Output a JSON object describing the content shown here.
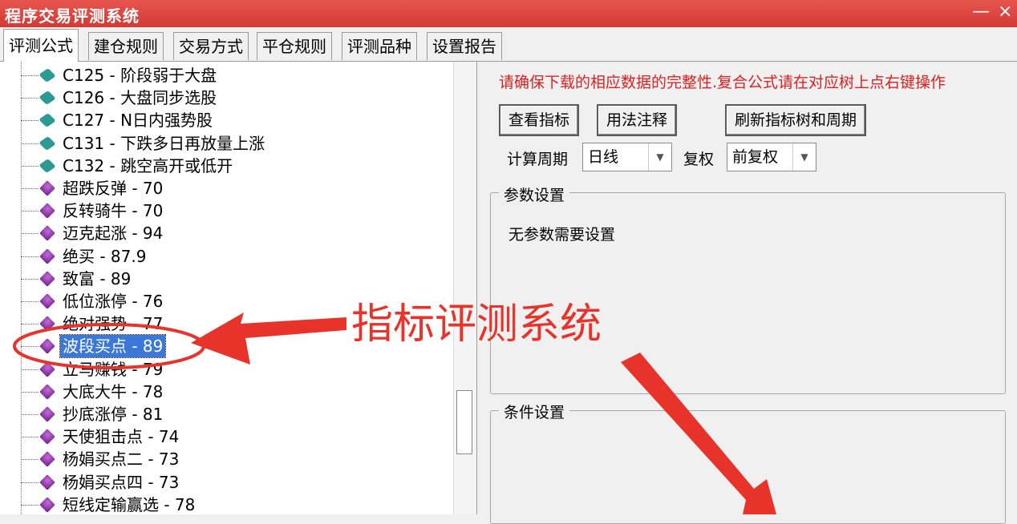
{
  "window": {
    "title": "程序交易评测系统",
    "close_glyph": "×",
    "minimize_glyph": "—"
  },
  "tabs": [
    {
      "label": "评测公式",
      "active": true
    },
    {
      "label": "建仓规则"
    },
    {
      "label": "交易方式"
    },
    {
      "label": "平仓规则"
    },
    {
      "label": "评测品种"
    },
    {
      "label": "设置报告"
    }
  ],
  "tree": {
    "items": [
      {
        "label": "C125 - 阶段弱于大盘",
        "icon": "teal-diamond-icon"
      },
      {
        "label": "C126 - 大盘同步选股",
        "icon": "teal-diamond-icon"
      },
      {
        "label": "C127 - N日内强势股",
        "icon": "teal-diamond-icon"
      },
      {
        "label": "C131 - 下跌多日再放量上涨",
        "icon": "teal-diamond-icon"
      },
      {
        "label": "C132 - 跳空高开或低开",
        "icon": "teal-diamond-icon"
      },
      {
        "label": "超跌反弹 - 70",
        "icon": "purple-gem-icon"
      },
      {
        "label": "反转骑牛 - 70",
        "icon": "purple-gem-icon"
      },
      {
        "label": "迈克起涨 - 94",
        "icon": "purple-gem-icon"
      },
      {
        "label": "绝买 - 87.9",
        "icon": "purple-gem-icon"
      },
      {
        "label": "致富 - 89",
        "icon": "purple-gem-icon"
      },
      {
        "label": "低位涨停 - 76",
        "icon": "purple-gem-icon"
      },
      {
        "label": "绝对强势 - 77",
        "icon": "purple-gem-icon"
      },
      {
        "label": "波段买点 - 89",
        "icon": "purple-gem-icon",
        "selected": true
      },
      {
        "label": "立马赚钱 - 79",
        "icon": "purple-gem-icon"
      },
      {
        "label": "大底大牛 - 78",
        "icon": "purple-gem-icon"
      },
      {
        "label": "抄底涨停 - 81",
        "icon": "purple-gem-icon"
      },
      {
        "label": "天使狙击点 - 74",
        "icon": "purple-gem-icon"
      },
      {
        "label": "杨娟买点二 - 73",
        "icon": "purple-gem-icon"
      },
      {
        "label": "杨娟买点四 - 73",
        "icon": "purple-gem-icon"
      },
      {
        "label": "短线定输赢选 - 78",
        "icon": "purple-gem-icon"
      }
    ]
  },
  "right": {
    "notice": "请确保下载的相应数据的完整性.复合公式请在对应树上点右键操作",
    "buttons": {
      "view_indicator": "查看指标",
      "usage_notes": "用法注释",
      "refresh_tree": "刷新指标树和周期"
    },
    "period_label": "计算周期",
    "period_value": "日线",
    "adjust_label": "复权",
    "adjust_value": "前复权",
    "params_group_title": "参数设置",
    "params_body": "无参数需要设置",
    "conditions_group_title": "条件设置"
  },
  "annotation": {
    "text": "指标评测系统",
    "color": "#e8332a"
  },
  "colors": {
    "titlebar": "#d9433d",
    "selection": "#3b78d8",
    "notice": "#e02020"
  }
}
